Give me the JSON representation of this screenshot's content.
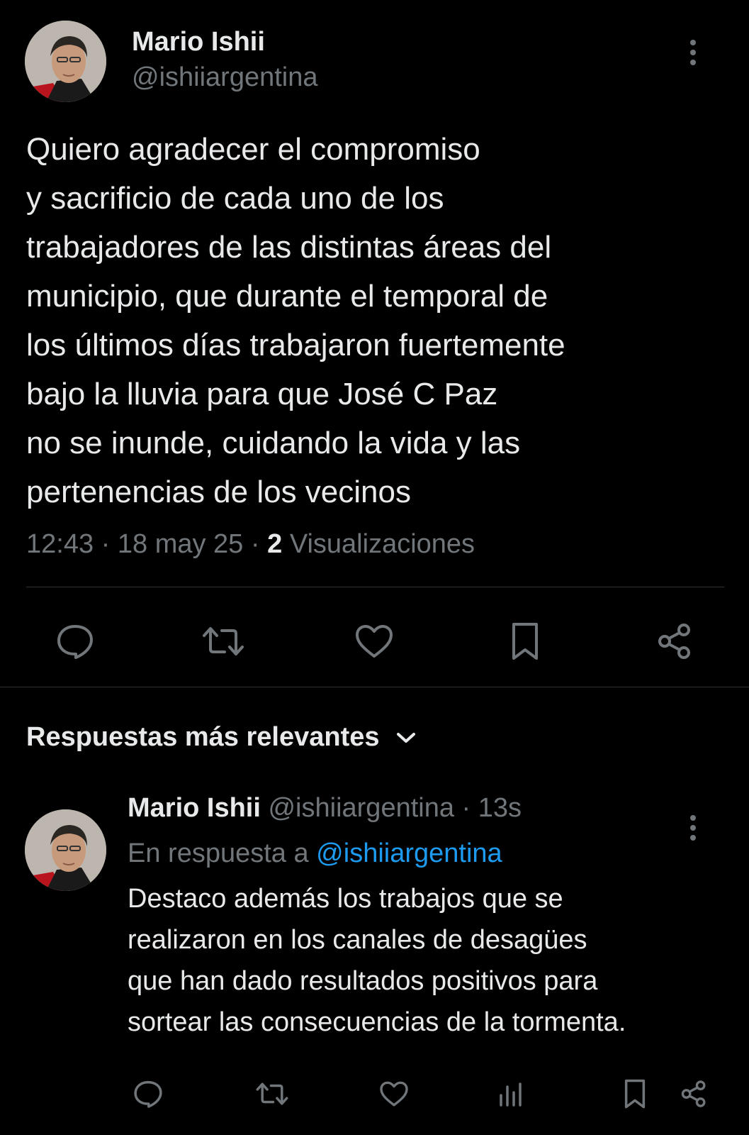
{
  "main_tweet": {
    "author_name": "Mario Ishii",
    "author_handle": "@ishiiargentina",
    "text_lines": [
      "Quiero agradecer el compromiso",
      "y sacrificio de cada uno de los",
      "trabajadores de las distintas áreas del",
      "municipio, que durante el temporal de",
      "los últimos días trabajaron fuertemente",
      "bajo la lluvia para que José C Paz",
      "no se inunde, cuidando la vida y las",
      "pertenencias de los vecinos"
    ],
    "time": "12:43",
    "separator": "·",
    "date": "18 may 25",
    "views_count": "2",
    "views_label": "Visualizaciones",
    "actions": [
      "chat-bubble-icon",
      "repost-icon",
      "heart-icon",
      "bookmark-icon",
      "share-icon"
    ]
  },
  "replies_section": {
    "sort_label": "Respuestas más relevantes"
  },
  "reply": {
    "author_name": "Mario Ishii",
    "author_handle": "@ishiiargentina",
    "separator": "·",
    "time_ago": "13s",
    "replying_to_prefix": "En respuesta a",
    "replying_to_handle": "@ishiiargentina",
    "text_lines": [
      "Destaco además los trabajos que se",
      "realizaron en los canales de desagües",
      "que han dado resultados positivos para",
      "sortear las consecuencias de la tormenta."
    ],
    "actions": [
      "chat-bubble-icon",
      "repost-icon",
      "heart-icon",
      "analytics-icon",
      "bookmark-icon",
      "share-icon"
    ]
  },
  "colors": {
    "background": "#000000",
    "primary_text": "#e7e9ea",
    "secondary_text": "#71767b",
    "link": "#1d9bf0",
    "divider": "#2f3336"
  }
}
